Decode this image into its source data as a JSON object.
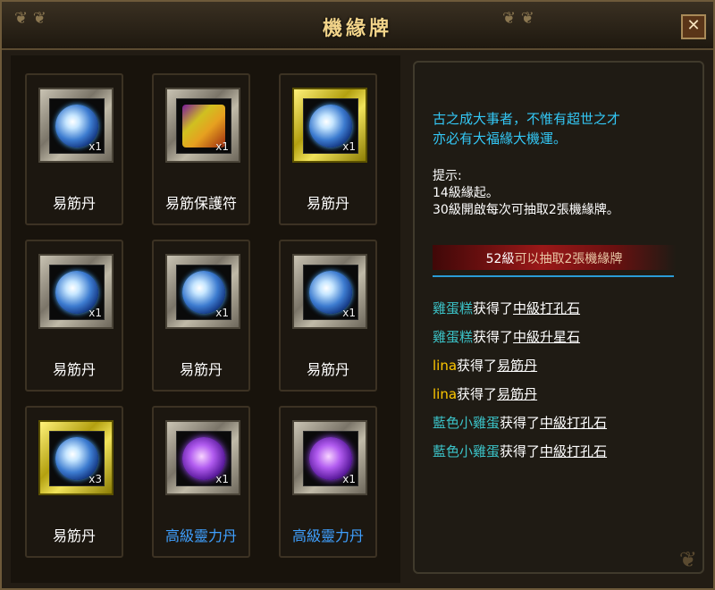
{
  "window": {
    "title": "機緣牌",
    "close": "✕"
  },
  "cards": [
    {
      "name": "易筋丹",
      "qty": "x1",
      "icon": "blue-orb-icon",
      "frame": "silver",
      "rare": false
    },
    {
      "name": "易筋保護符",
      "qty": "x1",
      "icon": "scroll-icon",
      "frame": "silver",
      "rare": false
    },
    {
      "name": "易筋丹",
      "qty": "x1",
      "icon": "blue-orb-icon",
      "frame": "gold",
      "rare": false
    },
    {
      "name": "易筋丹",
      "qty": "x1",
      "icon": "blue-orb-icon",
      "frame": "silver",
      "rare": false
    },
    {
      "name": "易筋丹",
      "qty": "x1",
      "icon": "blue-orb-icon",
      "frame": "silver",
      "rare": false
    },
    {
      "name": "易筋丹",
      "qty": "x1",
      "icon": "blue-orb-icon",
      "frame": "silver",
      "rare": false
    },
    {
      "name": "易筋丹",
      "qty": "x3",
      "icon": "blue-orb-icon",
      "frame": "gold",
      "rare": false
    },
    {
      "name": "高級靈力丹",
      "qty": "x1",
      "icon": "purple-orb-icon",
      "frame": "silver",
      "rare": true
    },
    {
      "name": "高級靈力丹",
      "qty": "x1",
      "icon": "purple-orb-icon",
      "frame": "silver",
      "rare": true
    }
  ],
  "info": {
    "slogan_line1": "古之成大事者，不惟有超世之才",
    "slogan_line2": "亦必有大福緣大機運。",
    "hint_title": "提示:",
    "hint_line1": "14級緣起。",
    "hint_line2": "30級開啟每次可抽取2張機緣牌。",
    "status_level": "52級",
    "status_text": "可以抽取2張機緣牌"
  },
  "log": [
    {
      "who": "雞蛋糕",
      "verb": "获得了",
      "item": "中級打孔石",
      "color": "#3bc3c8"
    },
    {
      "who": "雞蛋糕",
      "verb": "获得了",
      "item": "中級升星石",
      "color": "#3bc3c8"
    },
    {
      "who": "lina",
      "verb": "获得了",
      "item": "易筋丹",
      "color": "#ffc800"
    },
    {
      "who": "lina",
      "verb": "获得了",
      "item": "易筋丹",
      "color": "#ffc800"
    },
    {
      "who": "藍色小雞蛋",
      "verb": "获得了",
      "item": "中級打孔石",
      "color": "#3bc3c8"
    },
    {
      "who": "藍色小雞蛋",
      "verb": "获得了",
      "item": "中級打孔石",
      "color": "#3bc3c8"
    }
  ],
  "colors": {
    "accent": "#33c7f5",
    "rare_item": "#3fa0ff",
    "title": "#f2d48a"
  }
}
